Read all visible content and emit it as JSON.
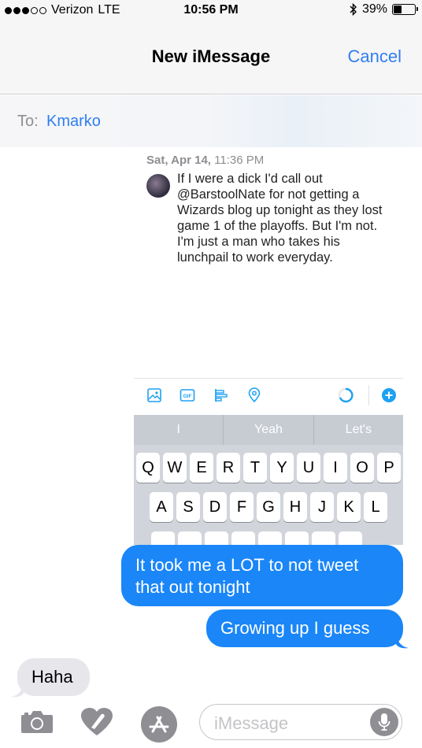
{
  "status_bar": {
    "carrier": "Verizon",
    "network": "LTE",
    "time": "10:56 PM",
    "battery": "39%",
    "battery_level": 0.39,
    "signal_bars_filled": 3,
    "signal_bars_total": 5
  },
  "nav": {
    "title": "New iMessage",
    "cancel_label": "Cancel"
  },
  "to_field": {
    "label": "To:",
    "recipient": "Kmarko"
  },
  "attachment": {
    "date_day": "Sat, Apr 14,",
    "date_time": "11:36 PM",
    "tweet_lines": [
      "If I were a dick I'd call out",
      "@BarstoolNate for not getting a",
      "Wizards blog up tonight as they lost",
      "game 1 of the playoffs.  But I'm not.",
      "I'm just a man who takes his",
      "lunchpail to work everyday."
    ],
    "predictions": [
      "I",
      "Yeah",
      "Let's"
    ],
    "keyboard_rows": [
      [
        "Q",
        "W",
        "E",
        "R",
        "T",
        "Y",
        "U",
        "I",
        "O",
        "P"
      ],
      [
        "A",
        "S",
        "D",
        "F",
        "G",
        "H",
        "J",
        "K",
        "L"
      ]
    ]
  },
  "messages": [
    {
      "direction": "sent",
      "lines": [
        "It took me a LOT to not tweet",
        "that out tonight"
      ]
    },
    {
      "direction": "sent",
      "lines": [
        "Growing up I guess"
      ]
    },
    {
      "direction": "received",
      "lines": [
        "Haha"
      ]
    }
  ],
  "input_bar": {
    "placeholder": "iMessage",
    "icons": [
      "camera-icon",
      "digital-touch-icon",
      "app-store-icon",
      "microphone-icon"
    ]
  },
  "colors": {
    "accent": "#2f7ef0",
    "sent_bubble": "#1a86f8",
    "received_bubble": "#e6e6eb"
  }
}
